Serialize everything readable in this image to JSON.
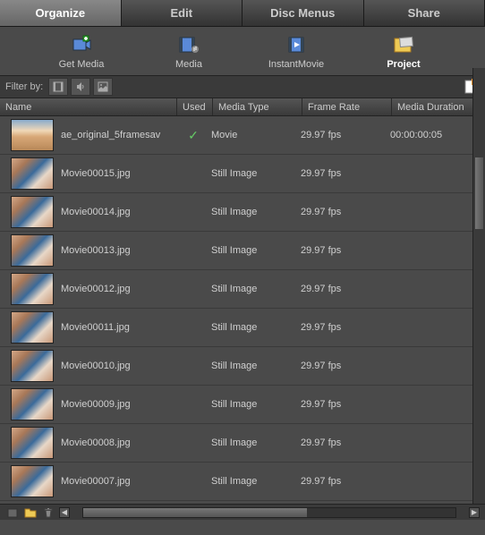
{
  "tabs": {
    "organize": "Organize",
    "edit": "Edit",
    "discmenus": "Disc Menus",
    "share": "Share"
  },
  "toolbar": {
    "getmedia": "Get Media",
    "media": "Media",
    "instantmovie": "InstantMovie",
    "project": "Project"
  },
  "filter": {
    "label": "Filter by:"
  },
  "headers": {
    "name": "Name",
    "used": "Used",
    "type": "Media Type",
    "fr": "Frame Rate",
    "dur": "Media Duration"
  },
  "rows": [
    {
      "name": "ae_original_5framesav",
      "used": true,
      "type": "Movie",
      "fr": "29.97 fps",
      "dur": "00:00:00:05",
      "portrait": true
    },
    {
      "name": "Movie00015.jpg",
      "used": false,
      "type": "Still Image",
      "fr": "29.97 fps",
      "dur": ""
    },
    {
      "name": "Movie00014.jpg",
      "used": false,
      "type": "Still Image",
      "fr": "29.97 fps",
      "dur": ""
    },
    {
      "name": "Movie00013.jpg",
      "used": false,
      "type": "Still Image",
      "fr": "29.97 fps",
      "dur": ""
    },
    {
      "name": "Movie00012.jpg",
      "used": false,
      "type": "Still Image",
      "fr": "29.97 fps",
      "dur": ""
    },
    {
      "name": "Movie00011.jpg",
      "used": false,
      "type": "Still Image",
      "fr": "29.97 fps",
      "dur": ""
    },
    {
      "name": "Movie00010.jpg",
      "used": false,
      "type": "Still Image",
      "fr": "29.97 fps",
      "dur": ""
    },
    {
      "name": "Movie00009.jpg",
      "used": false,
      "type": "Still Image",
      "fr": "29.97 fps",
      "dur": ""
    },
    {
      "name": "Movie00008.jpg",
      "used": false,
      "type": "Still Image",
      "fr": "29.97 fps",
      "dur": ""
    },
    {
      "name": "Movie00007.jpg",
      "used": false,
      "type": "Still Image",
      "fr": "29.97 fps",
      "dur": ""
    }
  ]
}
